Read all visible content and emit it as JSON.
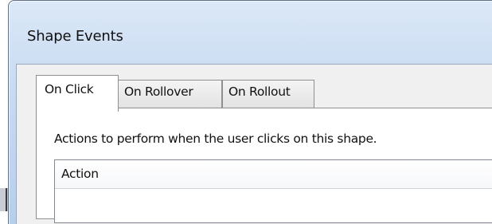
{
  "window": {
    "title": "Shape Events"
  },
  "tabs": [
    {
      "label": "On Click",
      "selected": true
    },
    {
      "label": "On Rollover",
      "selected": false
    },
    {
      "label": "On Rollout",
      "selected": false
    }
  ],
  "panel": {
    "description": "Actions to perform when the user clicks on this shape."
  },
  "actions_list": {
    "columns": [
      "Action"
    ],
    "rows": []
  }
}
